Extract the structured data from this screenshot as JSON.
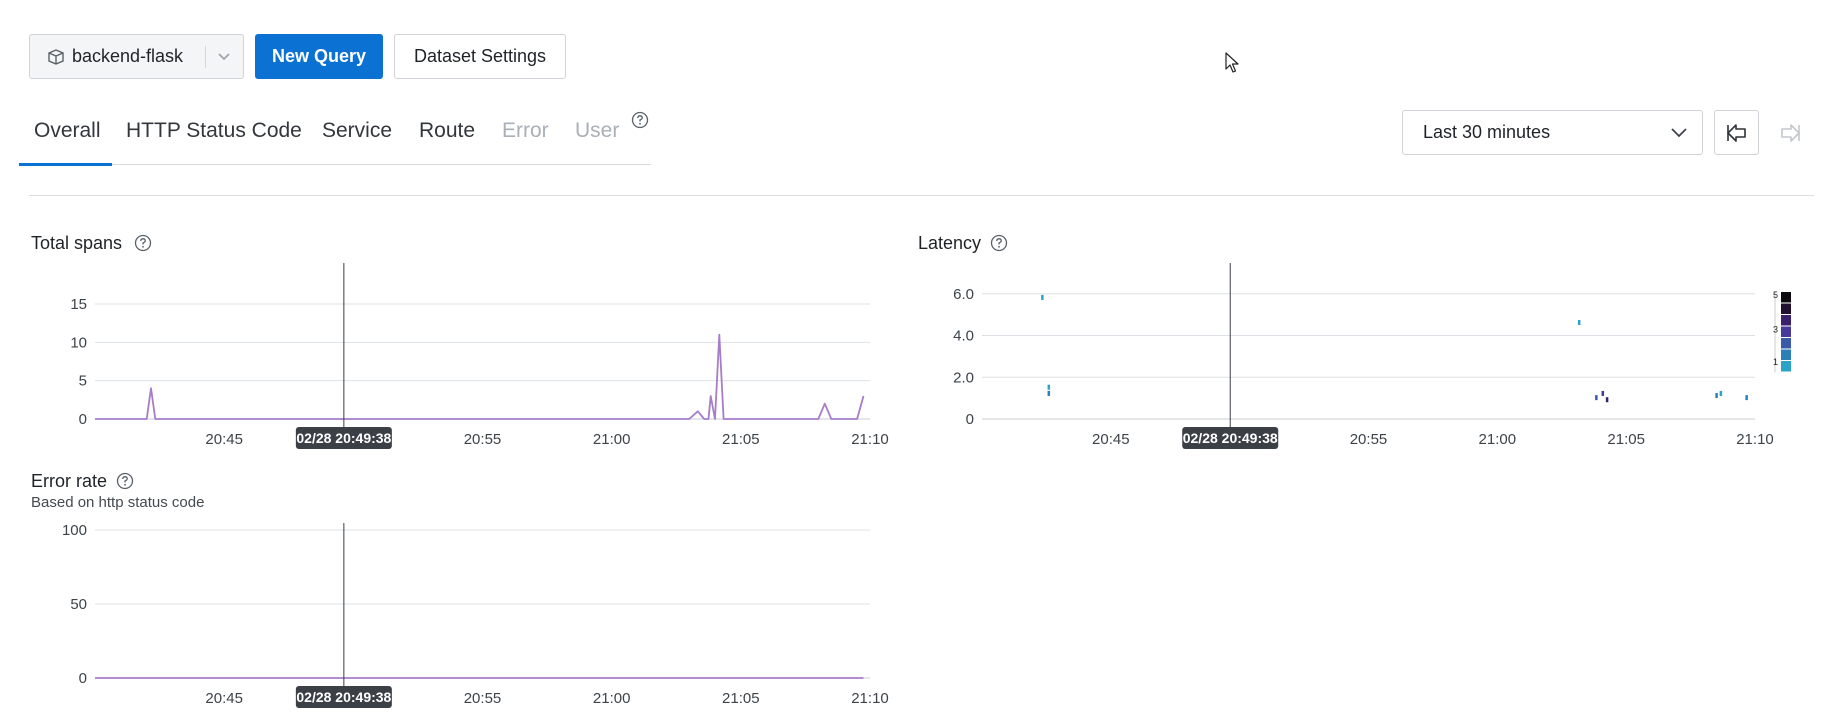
{
  "toolbar": {
    "dataset_name": "backend-flask",
    "new_query_label": "New Query",
    "dataset_settings_label": "Dataset Settings"
  },
  "tabs": [
    {
      "label": "Overall",
      "active": true,
      "disabled": false
    },
    {
      "label": "HTTP Status Code",
      "active": false,
      "disabled": false
    },
    {
      "label": "Service",
      "active": false,
      "disabled": false
    },
    {
      "label": "Route",
      "active": false,
      "disabled": false
    },
    {
      "label": "Error",
      "active": false,
      "disabled": true
    },
    {
      "label": "User",
      "active": false,
      "disabled": true
    }
  ],
  "time_range": {
    "selected": "Last 30 minutes"
  },
  "icons": {
    "dataset": "dataset-icon",
    "dropdown": "chevron-down-icon",
    "help": "help-icon",
    "back": "arrow-left-icon",
    "forward": "arrow-right-icon"
  },
  "colors": {
    "accent": "#0b72d3",
    "series_line": "#a77cc9",
    "hover_label_bg": "#3b4046",
    "heatmap_scale": [
      "#2aa3c6",
      "#2e7fb7",
      "#3a5ca8",
      "#47399a",
      "#3a1f6b",
      "#22102f",
      "#0c0a0f"
    ]
  },
  "cursor": {
    "timestamp": "02/28 20:49:38"
  },
  "chart_data": [
    {
      "type": "line",
      "title": "Total spans",
      "x_ticks": [
        "20:45",
        "20:50",
        "20:55",
        "21:00",
        "21:05",
        "21:10"
      ],
      "xlim": [
        "20:40",
        "21:10"
      ],
      "y_ticks": [
        0,
        5,
        10,
        15
      ],
      "ylim": [
        0,
        18
      ],
      "grid": true,
      "series": [
        {
          "x": [
            "20:40",
            "20:42",
            "20:42:10",
            "20:42:20",
            "20:42:35",
            "20:43",
            "21:03",
            "21:03:20",
            "21:03:35",
            "21:03:45",
            "21:03:50",
            "21:04",
            "21:04:10",
            "21:04:20",
            "21:04:40",
            "21:05",
            "21:08",
            "21:08:15",
            "21:08:30",
            "21:09:30",
            "21:09:45"
          ],
          "y": [
            0,
            0,
            4,
            0,
            0,
            0,
            0,
            1,
            0,
            0,
            3,
            0,
            11,
            0,
            0,
            0,
            0,
            2,
            0,
            0,
            3
          ]
        }
      ]
    },
    {
      "type": "heatmap",
      "title": "Latency",
      "x_ticks": [
        "20:45",
        "20:50",
        "20:55",
        "21:00",
        "21:05",
        "21:10"
      ],
      "xlim": [
        "20:40",
        "21:10"
      ],
      "y_ticks": [
        "0",
        "2.0",
        "4.0",
        "6.0"
      ],
      "ylim": [
        0,
        8
      ],
      "grid": true,
      "legend": {
        "position": "right",
        "labels": [
          "5",
          "3",
          "1"
        ]
      },
      "points": [
        {
          "x": "20:42:20",
          "y": 5.8,
          "count": 1
        },
        {
          "x": "20:42:35",
          "y": 1.5,
          "count": 1
        },
        {
          "x": "20:42:35",
          "y": 1.2,
          "count": 2
        },
        {
          "x": "21:03:10",
          "y": 4.6,
          "count": 1
        },
        {
          "x": "21:03:50",
          "y": 1.0,
          "count": 3
        },
        {
          "x": "21:04:05",
          "y": 1.2,
          "count": 4
        },
        {
          "x": "21:04:15",
          "y": 0.9,
          "count": 5
        },
        {
          "x": "21:08:30",
          "y": 1.1,
          "count": 2
        },
        {
          "x": "21:08:40",
          "y": 1.2,
          "count": 1
        },
        {
          "x": "21:09:40",
          "y": 1.0,
          "count": 2
        }
      ]
    },
    {
      "type": "line",
      "title": "Error rate",
      "subtitle": "Based on http status code",
      "x_ticks": [
        "20:45",
        "20:50",
        "20:55",
        "21:00",
        "21:05",
        "21:10"
      ],
      "xlim": [
        "20:40",
        "21:10"
      ],
      "y_ticks": [
        0,
        50,
        100
      ],
      "ylim": [
        0,
        150
      ],
      "grid": true,
      "series": [
        {
          "x": [
            "20:40",
            "21:09:45"
          ],
          "y": [
            0,
            0
          ]
        }
      ]
    }
  ]
}
